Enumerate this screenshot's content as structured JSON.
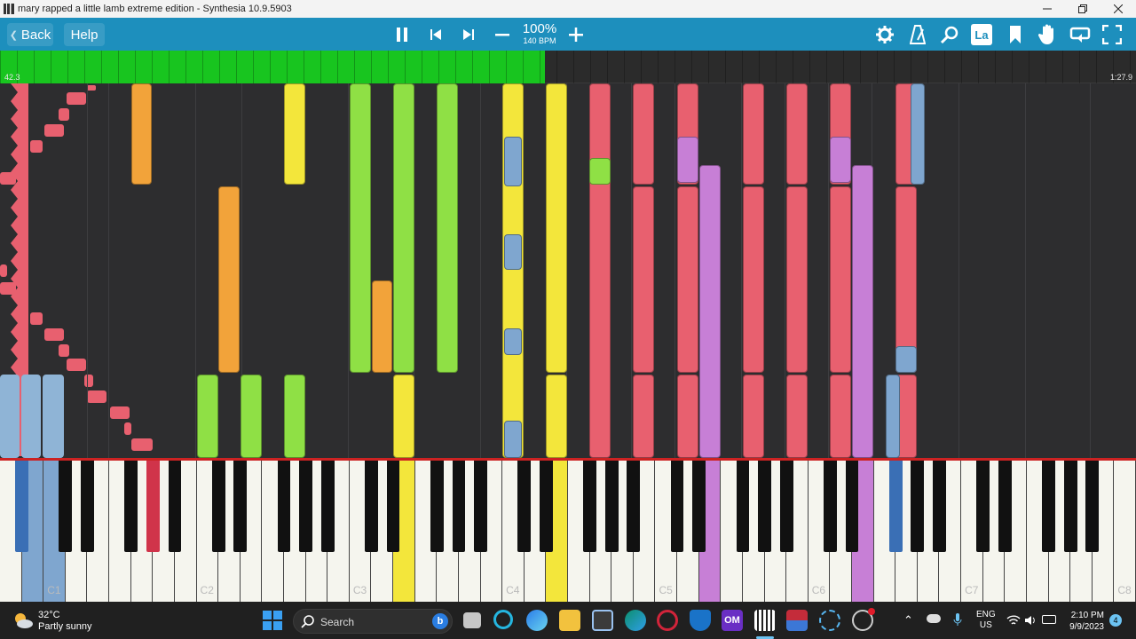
{
  "window": {
    "title": "mary rapped a little lamb extreme edition - Synthesia 10.9.5903",
    "minimize_icon": "minimize-icon",
    "restore_icon": "restore-icon",
    "close_icon": "close-icon"
  },
  "toolbar": {
    "back_label": "Back",
    "help_label": "Help",
    "speed_percent": "100%",
    "tempo": "140 BPM",
    "icons": [
      "pause-icon",
      "previous-icon",
      "next-icon",
      "minus-icon",
      "plus-icon",
      "settings-icon",
      "metronome-icon",
      "search-icon",
      "label-icon",
      "bookmark-icon",
      "hand-icon",
      "loop-icon",
      "fullscreen-icon"
    ],
    "label_button_text": "La"
  },
  "progress": {
    "elapsed": "42.3",
    "total": "1:27.9",
    "fraction": 0.48,
    "color": "#18c51f"
  },
  "piano": {
    "octave_labels": [
      "C1",
      "C2",
      "C3",
      "C4",
      "C5",
      "C6",
      "C7",
      "C8"
    ]
  },
  "taskbar": {
    "weather_temp": "32°C",
    "weather_desc": "Partly sunny",
    "search_placeholder": "Search",
    "language": "ENG",
    "region": "US",
    "time": "2:10 PM",
    "date": "9/9/2023",
    "notification_count": "4"
  },
  "colors": {
    "toolbar": "#1d8fbd",
    "note_red": "#e8606f",
    "note_green": "#8fe045",
    "note_yellow": "#f3e63b",
    "note_orange": "#f2a33a",
    "note_purple": "#c77fd6",
    "note_blue": "#7fa6cf"
  }
}
